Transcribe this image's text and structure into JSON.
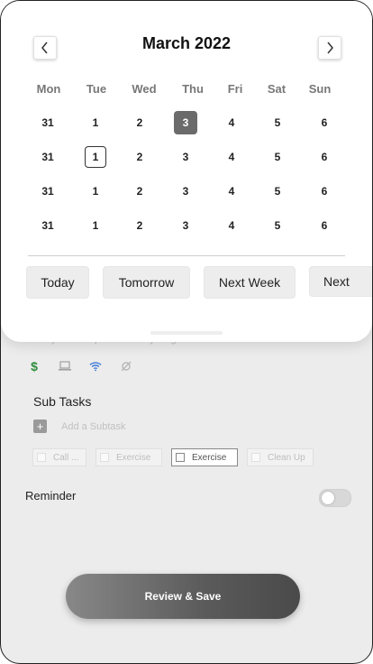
{
  "calendar": {
    "month_title": "March 2022",
    "weekdays": [
      "Mon",
      "Tue",
      "Wed",
      "Thu",
      "Fri",
      "Sat",
      "Sun"
    ],
    "weeks": [
      [
        "31",
        "1",
        "2",
        "3",
        "4",
        "5",
        "6"
      ],
      [
        "31",
        "1",
        "2",
        "3",
        "4",
        "5",
        "6"
      ],
      [
        "31",
        "1",
        "2",
        "3",
        "4",
        "5",
        "6"
      ],
      [
        "31",
        "1",
        "2",
        "3",
        "4",
        "5",
        "6"
      ]
    ],
    "prev_icon": "chevron-left-icon",
    "next_icon": "chevron-right-icon"
  },
  "quick_dates": [
    "Today",
    "Tomorrow",
    "Next Week",
    "Next"
  ],
  "background": {
    "partial_note": "10-Day Task Depends on Anything",
    "icons": [
      "dollar-icon",
      "laptop-icon",
      "wifi-icon",
      "link-off-icon"
    ],
    "icon_colors": {
      "dollar": "#2e8b3a",
      "laptop": "#a0a0a0",
      "wifi": "#3a78d8",
      "link": "#b8b8b8"
    },
    "subtasks_title": "Sub Tasks",
    "add_subtask": "Add a Subtask",
    "chips": [
      "Call ...",
      "Exercise",
      "Exercise",
      "Clean Up"
    ],
    "reminder_label": "Reminder",
    "save_label": "Review & Save"
  }
}
